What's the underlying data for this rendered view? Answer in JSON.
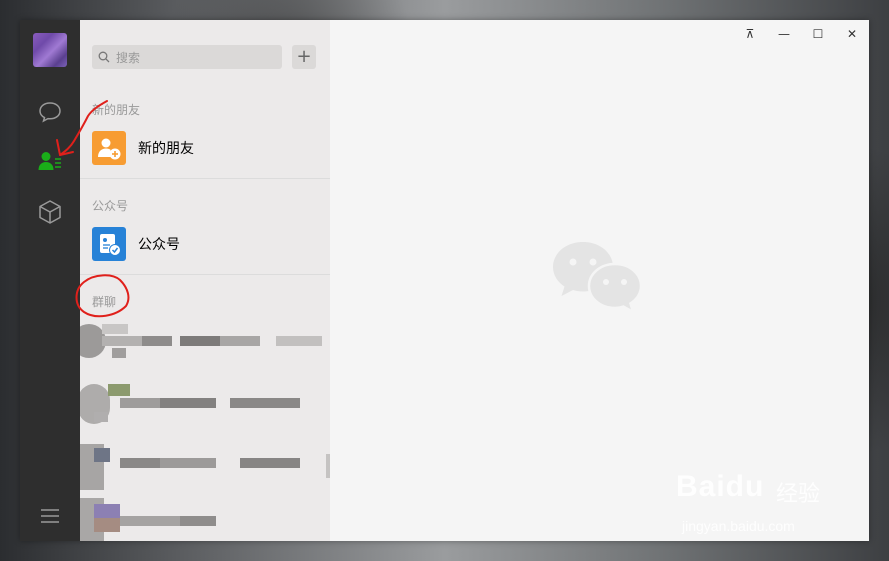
{
  "search": {
    "placeholder": "搜索"
  },
  "add_button": {
    "label": "+"
  },
  "sections": {
    "new_friends": "新的朋友",
    "official_accounts": "公众号",
    "group_chats": "群聊"
  },
  "items": {
    "new_friends": "新的朋友",
    "official_accounts": "公众号"
  },
  "window_controls": {
    "pin": "⊼",
    "minimize": "—",
    "maximize": "☐",
    "close": "✕"
  },
  "watermark": {
    "brand": "Baidu",
    "cn": "经验",
    "url": "jingyan.baidu.com"
  },
  "colors": {
    "nav_active": "#1aad19",
    "new_friend_icon": "#f79c32",
    "official_icon": "#2782d7",
    "annotation": "#e0201b"
  },
  "icons": [
    "chat-icon",
    "contacts-icon",
    "favorites-icon",
    "menu-icon",
    "search-icon",
    "wechat-logo-icon"
  ]
}
